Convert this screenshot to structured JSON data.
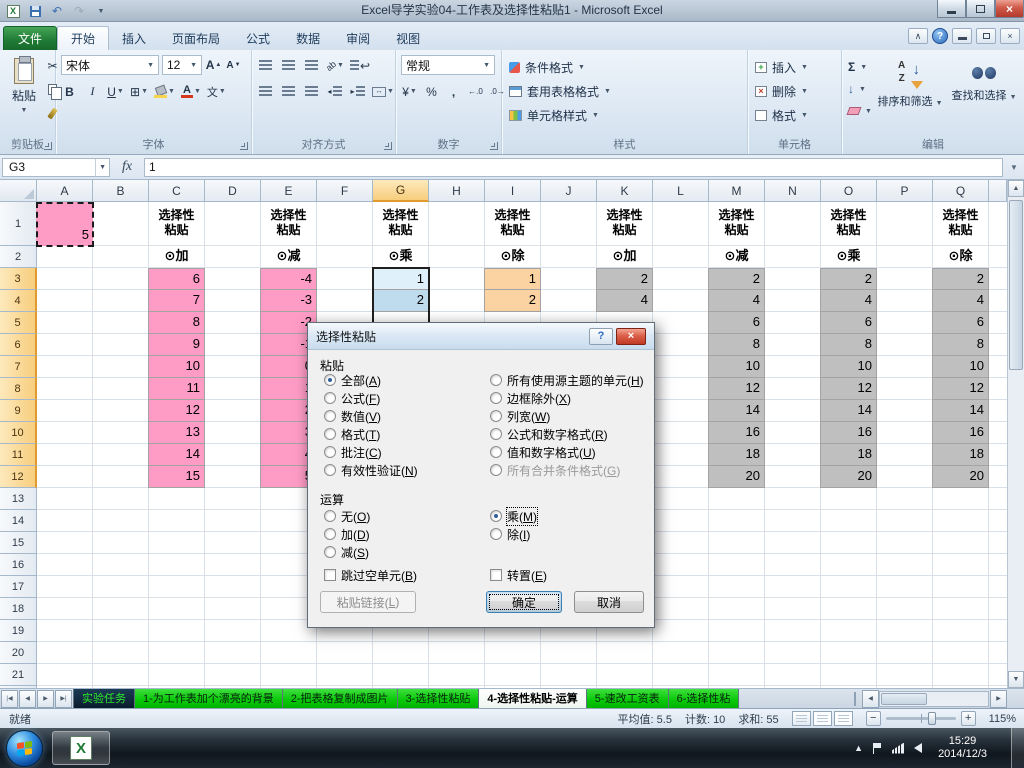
{
  "titlebar": {
    "title": "Excel导学实验04-工作表及选择性粘贴1 - Microsoft Excel"
  },
  "ribbon": {
    "file_tab": "文件",
    "tabs": [
      "开始",
      "插入",
      "页面布局",
      "公式",
      "数据",
      "审阅",
      "视图"
    ],
    "groups": {
      "clipboard": {
        "label": "剪贴板",
        "paste": "粘贴"
      },
      "font": {
        "label": "字体",
        "font_name": "宋体",
        "font_size": "12"
      },
      "align": {
        "label": "对齐方式"
      },
      "number": {
        "label": "数字",
        "format": "常规"
      },
      "styles": {
        "label": "样式",
        "items": [
          "条件格式",
          "套用表格格式",
          "单元格样式"
        ]
      },
      "cells": {
        "label": "单元格",
        "items": [
          "插入",
          "删除",
          "格式"
        ]
      },
      "editing": {
        "label": "编辑",
        "sort": "排序和筛选",
        "find": "查找和选择"
      }
    }
  },
  "formula_bar": {
    "name_box": "G3",
    "fx": "fx",
    "content": "1"
  },
  "sheet": {
    "columns": [
      "A",
      "B",
      "C",
      "D",
      "E",
      "F",
      "G",
      "H",
      "I",
      "J",
      "K",
      "L",
      "M",
      "N",
      "O",
      "P",
      "Q"
    ],
    "selected_col": "G",
    "selected_rows": [
      3,
      12
    ],
    "title_cells": {
      "cols": [
        "C",
        "E",
        "G",
        "I",
        "K",
        "M",
        "O",
        "Q"
      ],
      "text": "选择性\n粘贴"
    },
    "op_cells": {
      "C": "⊙加",
      "E": "⊙减",
      "G": "⊙乘",
      "I": "⊙除",
      "K": "⊙加",
      "M": "⊙减",
      "O": "⊙乘",
      "Q": "⊙除"
    },
    "fills": {
      "pink": "#FF9CC6",
      "sel_active": "#DFF0FA",
      "sel": "#BFDCEF",
      "orange": "#FBD2A2",
      "gray": "#BFBFBF"
    },
    "value_cells": [
      [
        "A",
        1,
        "5",
        "pink"
      ],
      [
        "C",
        3,
        "6",
        "pink"
      ],
      [
        "C",
        4,
        "7",
        "pink"
      ],
      [
        "C",
        5,
        "8",
        "pink"
      ],
      [
        "C",
        6,
        "9",
        "pink"
      ],
      [
        "C",
        7,
        "10",
        "pink"
      ],
      [
        "C",
        8,
        "11",
        "pink"
      ],
      [
        "C",
        9,
        "12",
        "pink"
      ],
      [
        "C",
        10,
        "13",
        "pink"
      ],
      [
        "C",
        11,
        "14",
        "pink"
      ],
      [
        "C",
        12,
        "15",
        "pink"
      ],
      [
        "E",
        3,
        "-4",
        "pink"
      ],
      [
        "E",
        4,
        "-3",
        "pink"
      ],
      [
        "E",
        5,
        "-2",
        "pink"
      ],
      [
        "E",
        6,
        "-1",
        "pink"
      ],
      [
        "E",
        7,
        "0",
        "pink"
      ],
      [
        "E",
        8,
        "1",
        "pink"
      ],
      [
        "E",
        9,
        "2",
        "pink"
      ],
      [
        "E",
        10,
        "3",
        "pink"
      ],
      [
        "E",
        11,
        "4",
        "pink"
      ],
      [
        "E",
        12,
        "5",
        "pink"
      ],
      [
        "G",
        3,
        "1",
        "sel_active"
      ],
      [
        "G",
        4,
        "2",
        "sel"
      ],
      [
        "I",
        3,
        "1",
        "orange"
      ],
      [
        "I",
        4,
        "2",
        "orange"
      ],
      [
        "K",
        3,
        "2",
        "gray"
      ],
      [
        "K",
        4,
        "4",
        "gray"
      ],
      [
        "M",
        3,
        "2",
        "gray"
      ],
      [
        "M",
        4,
        "4",
        "gray"
      ],
      [
        "M",
        5,
        "6",
        "gray"
      ],
      [
        "M",
        6,
        "8",
        "gray"
      ],
      [
        "M",
        7,
        "10",
        "gray"
      ],
      [
        "M",
        8,
        "12",
        "gray"
      ],
      [
        "M",
        9,
        "14",
        "gray"
      ],
      [
        "M",
        10,
        "16",
        "gray"
      ],
      [
        "M",
        11,
        "18",
        "gray"
      ],
      [
        "M",
        12,
        "20",
        "gray"
      ],
      [
        "O",
        3,
        "2",
        "gray"
      ],
      [
        "O",
        4,
        "4",
        "gray"
      ],
      [
        "O",
        5,
        "6",
        "gray"
      ],
      [
        "O",
        6,
        "8",
        "gray"
      ],
      [
        "O",
        7,
        "10",
        "gray"
      ],
      [
        "O",
        8,
        "12",
        "gray"
      ],
      [
        "O",
        9,
        "14",
        "gray"
      ],
      [
        "O",
        10,
        "16",
        "gray"
      ],
      [
        "O",
        11,
        "18",
        "gray"
      ],
      [
        "O",
        12,
        "20",
        "gray"
      ],
      [
        "Q",
        3,
        "2",
        "gray"
      ],
      [
        "Q",
        4,
        "4",
        "gray"
      ],
      [
        "Q",
        5,
        "6",
        "gray"
      ],
      [
        "Q",
        6,
        "8",
        "gray"
      ],
      [
        "Q",
        7,
        "10",
        "gray"
      ],
      [
        "Q",
        8,
        "12",
        "gray"
      ],
      [
        "Q",
        9,
        "14",
        "gray"
      ],
      [
        "Q",
        10,
        "16",
        "gray"
      ],
      [
        "Q",
        11,
        "18",
        "gray"
      ],
      [
        "Q",
        12,
        "20",
        "gray"
      ]
    ]
  },
  "dialog": {
    "title": "选择性粘贴",
    "section_paste": "粘贴",
    "paste_options_left": [
      {
        "label": "全部(A)",
        "selected": true
      },
      {
        "label": "公式(F)"
      },
      {
        "label": "数值(V)"
      },
      {
        "label": "格式(T)"
      },
      {
        "label": "批注(C)"
      },
      {
        "label": "有效性验证(N)"
      }
    ],
    "paste_options_right": [
      {
        "label": "所有使用源主题的单元(H)"
      },
      {
        "label": "边框除外(X)"
      },
      {
        "label": "列宽(W)"
      },
      {
        "label": "公式和数字格式(R)"
      },
      {
        "label": "值和数字格式(U)"
      },
      {
        "label": "所有合并条件格式(G)",
        "disabled": true
      }
    ],
    "section_operation": "运算",
    "operation_left": [
      {
        "label": "无(O)"
      },
      {
        "label": "加(D)"
      },
      {
        "label": "减(S)"
      }
    ],
    "operation_right": [
      {
        "label": "乘(M)",
        "selected": true,
        "focused": true
      },
      {
        "label": "除(I)"
      }
    ],
    "skip_blanks": "跳过空单元(B)",
    "transpose": "转置(E)",
    "paste_link_button": "粘贴链接(L)",
    "ok_button": "确定",
    "cancel_button": "取消"
  },
  "sheet_tabs": {
    "items": [
      "实验任务",
      "1-为工作表加个漂亮的背景",
      "2-把表格复制成图片",
      "3-选择性粘贴",
      "4-选择性粘贴-运算",
      "5-速改工资表",
      "6-选择性粘"
    ],
    "active_index": 4
  },
  "status_bar": {
    "mode": "就绪",
    "average": "平均值: 5.5",
    "count": "计数: 10",
    "sum": "求和: 55",
    "zoom": "115%"
  },
  "taskbar": {
    "time": "15:29",
    "date": "2014/12/3"
  }
}
